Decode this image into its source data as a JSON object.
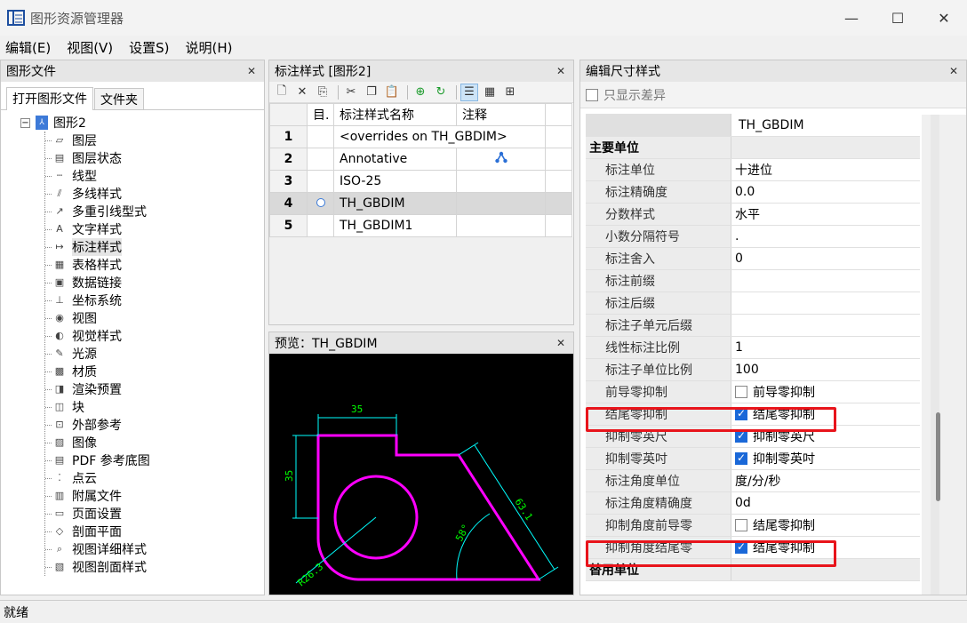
{
  "window": {
    "title": "图形资源管理器",
    "minimize": "—",
    "maximize": "☐",
    "close": "✕"
  },
  "menu": [
    "编辑(E)",
    "视图(V)",
    "设置S)",
    "说明(H)"
  ],
  "left_panel": {
    "title": "图形文件",
    "tabs": [
      "打开图形文件",
      "文件夹"
    ],
    "root": "图形2",
    "items": [
      "图层",
      "图层状态",
      "线型",
      "多线样式",
      "多重引线型式",
      "文字样式",
      "标注样式",
      "表格样式",
      "数据链接",
      "坐标系统",
      "视图",
      "视觉样式",
      "光源",
      "材质",
      "渲染预置",
      "块",
      "外部参考",
      "图像",
      "PDF 参考底图",
      "点云",
      "附属文件",
      "页面设置",
      "剖面平面",
      "视图详细样式",
      "视图剖面样式"
    ],
    "selected_index": 6
  },
  "styles_panel": {
    "title": "标注样式 [图形2]",
    "columns": [
      "目.",
      "标注样式名称",
      "注释"
    ],
    "rows": [
      {
        "num": "1",
        "name": "<overrides on TH_GBDIM>"
      },
      {
        "num": "2",
        "name": "Annotative"
      },
      {
        "num": "3",
        "name": "ISO-25"
      },
      {
        "num": "4",
        "name": "TH_GBDIM"
      },
      {
        "num": "5",
        "name": "TH_GBDIM1"
      }
    ],
    "selected_row": 3
  },
  "preview_panel": {
    "title": "预览：TH_GBDIM",
    "dims": {
      "top": "35",
      "left": "35",
      "slant": "63.1",
      "angle": "58°",
      "radius": "R26.3"
    }
  },
  "edit_panel": {
    "title": "编辑尺寸样式",
    "filter_label": "只显示差异",
    "header_value": "TH_GBDIM",
    "category1": "主要单位",
    "props": [
      {
        "name": "标注单位",
        "value": "十进位",
        "checked": null
      },
      {
        "name": "标注精确度",
        "value": "0.0",
        "checked": null
      },
      {
        "name": "分数样式",
        "value": "水平",
        "checked": null
      },
      {
        "name": "小数分隔符号",
        "value": ".",
        "checked": null
      },
      {
        "name": "标注舍入",
        "value": "0",
        "checked": null
      },
      {
        "name": "标注前缀",
        "value": "",
        "checked": null
      },
      {
        "name": "标注后缀",
        "value": "",
        "checked": null
      },
      {
        "name": "标注子单元后缀",
        "value": "",
        "checked": null
      },
      {
        "name": "线性标注比例",
        "value": "1",
        "checked": null
      },
      {
        "name": "标注子单位比例",
        "value": "100",
        "checked": null
      },
      {
        "name": "前导零抑制",
        "value": "前导零抑制",
        "checked": false
      },
      {
        "name": "结尾零抑制",
        "value": "结尾零抑制",
        "checked": true
      },
      {
        "name": "抑制零英尺",
        "value": "抑制零英尺",
        "checked": true
      },
      {
        "name": "抑制零英吋",
        "value": "抑制零英吋",
        "checked": true
      },
      {
        "name": "标注角度单位",
        "value": "度/分/秒",
        "checked": null
      },
      {
        "name": "标注角度精确度",
        "value": "0d",
        "checked": null
      },
      {
        "name": "抑制角度前导零",
        "value": "结尾零抑制",
        "checked": false
      },
      {
        "name": "抑制角度结尾零",
        "value": "结尾零抑制",
        "checked": true
      }
    ],
    "category2": "替用单位"
  },
  "status": "就绪",
  "colors": {
    "highlight": "#e8141b",
    "checkbox": "#1a68d8",
    "preview_shape": "#ff00ff",
    "preview_dim": "#00ffff",
    "preview_text": "#00ff00"
  }
}
